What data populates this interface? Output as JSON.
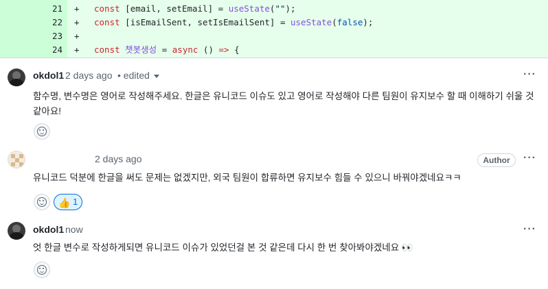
{
  "diff": {
    "lines": [
      {
        "num": "21",
        "sign": "+",
        "code": "const [email, setEmail] = useState(\"\");"
      },
      {
        "num": "22",
        "sign": "+",
        "code": "const [isEmailSent, setIsEmailSent] = useState(false);"
      },
      {
        "num": "23",
        "sign": "+",
        "code": ""
      },
      {
        "num": "24",
        "sign": "+",
        "code": "const 챗봇생성 = async () => {"
      }
    ]
  },
  "comments": [
    {
      "author": "okdol1",
      "time": "2 days ago",
      "edited": "• edited",
      "body": "함수명, 변수명은 영어로 작성해주세요. 한글은 유니코드 이슈도 있고 영어로 작성해야 다른 팀원이 유지보수 할 때 이해하기 쉬울 것 같아요!",
      "more": "···"
    },
    {
      "author": "",
      "time": "2 days ago",
      "badge": "Author",
      "body": "유니코드 덕분에 한글을 써도 문제는 없겠지만, 외국 팀원이 합류하면 유지보수 힘들 수 있으니 바꿔야겠네요ㅋㅋ",
      "reaction": {
        "emoji": "👍",
        "count": "1"
      },
      "more": "···"
    },
    {
      "author": "okdol1",
      "time": "now",
      "body": "엇 한글 변수로 작성하게되면 유니코드 이슈가 있었던걸 본 것 같은데 다시 한 번 찾아봐야겠네요 👀",
      "more": "···"
    }
  ],
  "colors": {
    "diff_bg": "#e6ffec",
    "line_num_bg": "#ccffd8",
    "keyword": "#cf222e",
    "function": "#8250df",
    "reaction_active": "#0969da"
  },
  "icons": {
    "avatar": "user-avatar",
    "add_reaction": "smiley-icon",
    "more": "kebab-icon",
    "caret": "caret-down-icon"
  }
}
